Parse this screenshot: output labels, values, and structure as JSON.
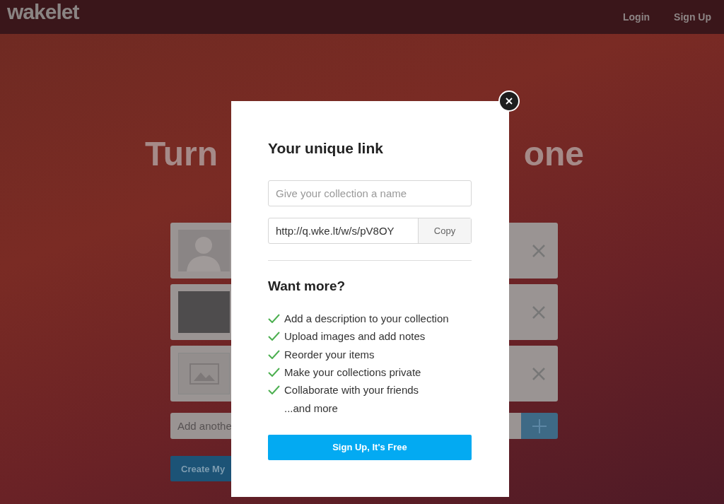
{
  "header": {
    "logo": "wakelet",
    "nav": [
      "Login",
      "Sign Up"
    ]
  },
  "hero": {
    "heading_left": "Turn",
    "heading_right": "one"
  },
  "cards": [
    {
      "kind": "avatar"
    },
    {
      "kind": "photo"
    },
    {
      "kind": "image"
    }
  ],
  "add_field": {
    "placeholder": "Add anothe"
  },
  "create_button": "Create My",
  "modal": {
    "title": "Your unique link",
    "name_placeholder": "Give your collection a name",
    "link": "http://q.wke.lt/w/s/pV8OY",
    "copy_button": "Copy",
    "subtitle": "Want more?",
    "features": [
      {
        "kind": "check",
        "text": "Add a description to your collection"
      },
      {
        "kind": "check",
        "text": "Upload images and add notes"
      },
      {
        "kind": "check",
        "text": "Reorder your items"
      },
      {
        "kind": "check",
        "text": "Make your collections private"
      },
      {
        "kind": "check",
        "text": "Collaborate with your friends"
      },
      {
        "kind": "plain",
        "text": "...and more"
      }
    ],
    "signup_button": "Sign Up, It's Free"
  }
}
